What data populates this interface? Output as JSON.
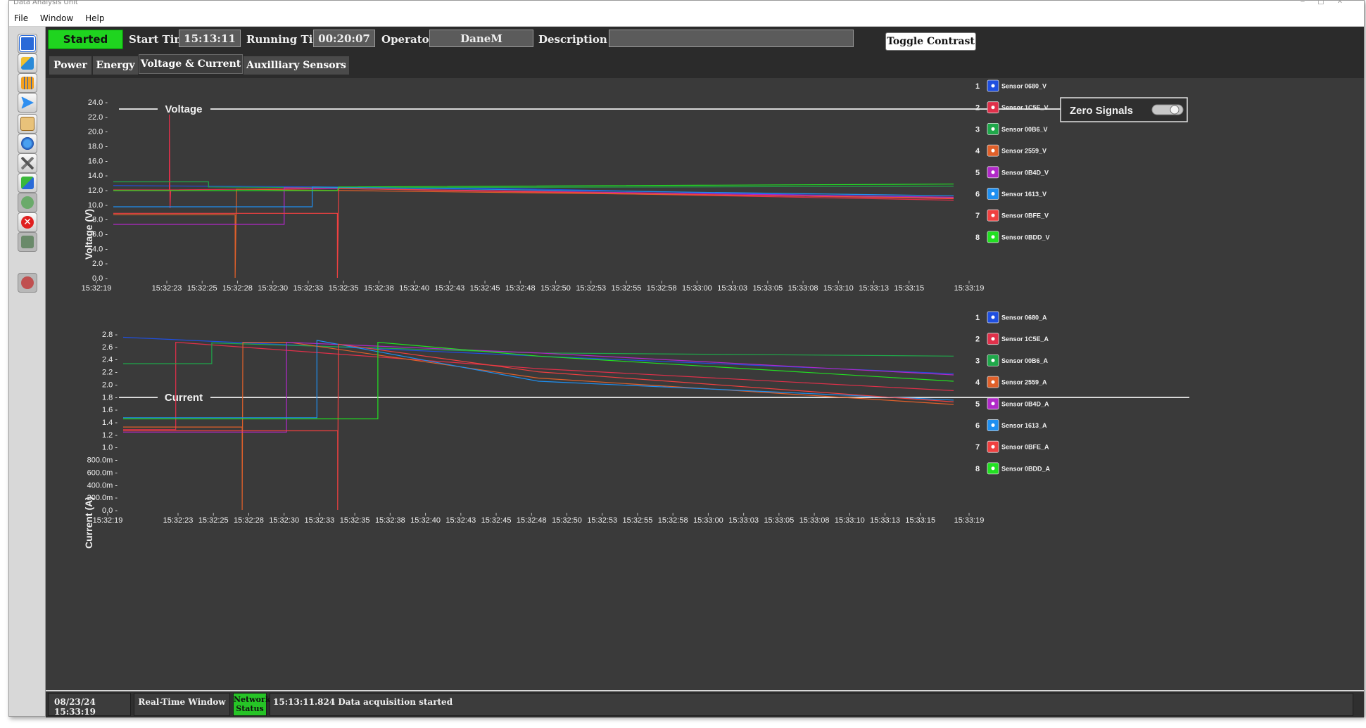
{
  "window": {
    "title": "Data Analysis Unit"
  },
  "menu": [
    "File",
    "Window",
    "Help"
  ],
  "toolbar_icons": [
    "window-icon",
    "monitor-icon",
    "calendar-icon",
    "send-icon",
    "notes-icon",
    "globe-icon",
    "tools-icon",
    "refresh-icon",
    "play-icon",
    "stop-icon",
    "download-icon",
    "power-icon"
  ],
  "topbar": {
    "status": "Started",
    "start_time_label": "Start Time",
    "start_time": "15:13:11",
    "running_time_label": "Running Time",
    "running_time": "00:20:07",
    "operator_label": "Operator",
    "operator": "DaneM",
    "description_label": "Description",
    "description": "",
    "toggle_contrast": "Toggle Contrast"
  },
  "tabs": [
    "Power",
    "Energy",
    "Voltage & Current",
    "Auxilliary Sensors"
  ],
  "active_tab": "Voltage & Current",
  "zero_signals_label": "Zero Signals",
  "legend_voltage": [
    {
      "num": "1",
      "name": "Sensor 0680_V",
      "color": "#1f4fe0"
    },
    {
      "num": "2",
      "name": "Sensor 1C5E_V",
      "color": "#e0304a"
    },
    {
      "num": "3",
      "name": "Sensor 00B6_V",
      "color": "#1fa84a"
    },
    {
      "num": "4",
      "name": "Sensor 2559_V",
      "color": "#e0602a"
    },
    {
      "num": "5",
      "name": "Sensor 0B4D_V",
      "color": "#b028c8"
    },
    {
      "num": "6",
      "name": "Sensor 1613_V",
      "color": "#1e8ff0"
    },
    {
      "num": "7",
      "name": "Sensor 0BFE_V",
      "color": "#f04040"
    },
    {
      "num": "8",
      "name": "Sensor 0BDD_V",
      "color": "#22e022"
    }
  ],
  "legend_current": [
    {
      "num": "1",
      "name": "Sensor 0680_A",
      "color": "#1f4fe0"
    },
    {
      "num": "2",
      "name": "Sensor 1C5E_A",
      "color": "#e0304a"
    },
    {
      "num": "3",
      "name": "Sensor 00B6_A",
      "color": "#1fa84a"
    },
    {
      "num": "4",
      "name": "Sensor 2559_A",
      "color": "#e0602a"
    },
    {
      "num": "5",
      "name": "Sensor 0B4D_A",
      "color": "#b028c8"
    },
    {
      "num": "6",
      "name": "Sensor 1613_A",
      "color": "#1e8ff0"
    },
    {
      "num": "7",
      "name": "Sensor 0BFE_A",
      "color": "#f04040"
    },
    {
      "num": "8",
      "name": "Sensor 0BDD_A",
      "color": "#22e022"
    }
  ],
  "chart_data": [
    {
      "type": "line",
      "title": "Voltage",
      "ylabel": "Voltage (V)",
      "xlabel": "",
      "ylim": [
        0,
        24
      ],
      "yticks": [
        "24.0",
        "22.0",
        "20.0",
        "18.0",
        "16.0",
        "14.0",
        "12.0",
        "10.0",
        "8.0",
        "6.0",
        "4.0",
        "2.0",
        "0.0"
      ],
      "xticks": [
        "15:32:19",
        "15:32:23",
        "15:32:25",
        "15:32:28",
        "15:32:30",
        "15:32:33",
        "15:32:35",
        "15:32:38",
        "15:32:40",
        "15:32:43",
        "15:32:45",
        "15:32:48",
        "15:32:50",
        "15:32:53",
        "15:32:55",
        "15:32:58",
        "15:33:00",
        "15:33:03",
        "15:33:05",
        "15:33:08",
        "15:33:10",
        "15:33:13",
        "15:33:15",
        "15:33:19"
      ],
      "xrange_sec": [
        0,
        60
      ],
      "series": [
        {
          "name": "Sensor 0680_V",
          "color": "#1f4fe0",
          "points": [
            [
              0,
              12.6
            ],
            [
              15,
              12.4
            ],
            [
              28,
              12.2
            ],
            [
              60,
              10.9
            ]
          ]
        },
        {
          "name": "Sensor 1C5E_V",
          "color": "#e0304a",
          "points": [
            [
              0,
              12.0
            ],
            [
              4,
              12.0
            ],
            [
              4,
              22.3
            ],
            [
              4.05,
              9.5
            ],
            [
              4.1,
              12.0
            ],
            [
              16,
              12.2
            ],
            [
              60,
              10.6
            ]
          ]
        },
        {
          "name": "Sensor 00B6_V",
          "color": "#1fa84a",
          "points": [
            [
              0,
              13.1
            ],
            [
              6.8,
              13.1
            ],
            [
              6.8,
              12.4
            ],
            [
              16,
              12.3
            ],
            [
              60,
              12.5
            ]
          ]
        },
        {
          "name": "Sensor 2559_V",
          "color": "#e0602a",
          "points": [
            [
              0,
              8.6
            ],
            [
              8.7,
              8.6
            ],
            [
              8.7,
              0
            ],
            [
              8.8,
              12.1
            ],
            [
              60,
              10.9
            ]
          ]
        },
        {
          "name": "Sensor 0B4D_V",
          "color": "#b028c8",
          "points": [
            [
              0,
              7.3
            ],
            [
              12.2,
              7.3
            ],
            [
              12.2,
              12.3
            ],
            [
              60,
              11.0
            ]
          ]
        },
        {
          "name": "Sensor 1613_V",
          "color": "#1e8ff0",
          "points": [
            [
              0,
              9.7
            ],
            [
              14.2,
              9.7
            ],
            [
              14.2,
              12.4
            ],
            [
              60,
              11.2
            ]
          ]
        },
        {
          "name": "Sensor 0BFE_V",
          "color": "#f04040",
          "points": [
            [
              0,
              8.8
            ],
            [
              16,
              8.8
            ],
            [
              16,
              0
            ],
            [
              16.1,
              12.2
            ],
            [
              60,
              10.8
            ]
          ]
        },
        {
          "name": "Sensor 0BDD_V",
          "color": "#22e022",
          "points": [
            [
              0,
              11.9
            ],
            [
              16,
              11.9
            ],
            [
              16.1,
              12.4
            ],
            [
              60,
              12.8
            ]
          ]
        }
      ]
    },
    {
      "type": "line",
      "title": "Current",
      "ylabel": "Current (A)",
      "xlabel": "",
      "ylim": [
        0,
        2.8
      ],
      "yticks": [
        "2.8",
        "2.6",
        "2.4",
        "2.2",
        "2.0",
        "1.8",
        "1.6",
        "1.4",
        "1.2",
        "1.0",
        "800.0m",
        "600.0m",
        "400.0m",
        "200.0m",
        "0.0"
      ],
      "xticks": [
        "15:32:19",
        "15:32:23",
        "15:32:25",
        "15:32:28",
        "15:32:30",
        "15:32:33",
        "15:32:35",
        "15:32:38",
        "15:32:40",
        "15:32:43",
        "15:32:45",
        "15:32:48",
        "15:32:50",
        "15:32:53",
        "15:32:55",
        "15:32:58",
        "15:33:00",
        "15:33:03",
        "15:33:05",
        "15:33:08",
        "15:33:10",
        "15:33:13",
        "15:33:15",
        "15:33:19"
      ],
      "xrange_sec": [
        0,
        60
      ],
      "series": [
        {
          "name": "Sensor 0680_A",
          "color": "#1f4fe0",
          "points": [
            [
              0,
              2.75
            ],
            [
              15,
              2.6
            ],
            [
              30,
              2.45
            ],
            [
              60,
              2.17
            ]
          ]
        },
        {
          "name": "Sensor 1C5E_A",
          "color": "#e0304a",
          "points": [
            [
              0,
              1.28
            ],
            [
              3.8,
              1.28
            ],
            [
              3.8,
              2.67
            ],
            [
              30,
              2.25
            ],
            [
              60,
              1.9
            ]
          ]
        },
        {
          "name": "Sensor 00B6_A",
          "color": "#1fa84a",
          "points": [
            [
              0,
              2.33
            ],
            [
              6.4,
              2.33
            ],
            [
              6.4,
              2.66
            ],
            [
              30,
              2.5
            ],
            [
              60,
              2.45
            ]
          ]
        },
        {
          "name": "Sensor 2559_A",
          "color": "#e0602a",
          "points": [
            [
              0,
              1.32
            ],
            [
              8.6,
              1.32
            ],
            [
              8.6,
              0
            ],
            [
              8.65,
              2.67
            ],
            [
              12,
              2.67
            ],
            [
              30,
              2.1
            ],
            [
              60,
              1.68
            ]
          ]
        },
        {
          "name": "Sensor 0B4D_A",
          "color": "#b028c8",
          "points": [
            [
              0,
              1.24
            ],
            [
              11.8,
              1.24
            ],
            [
              11.8,
              2.67
            ],
            [
              30,
              2.5
            ],
            [
              60,
              2.15
            ]
          ]
        },
        {
          "name": "Sensor 1613_A",
          "color": "#1e8ff0",
          "points": [
            [
              0,
              1.47
            ],
            [
              14,
              1.47
            ],
            [
              14,
              2.7
            ],
            [
              30,
              2.05
            ],
            [
              60,
              1.75
            ]
          ]
        },
        {
          "name": "Sensor 0BFE_A",
          "color": "#f04040",
          "points": [
            [
              0,
              1.26
            ],
            [
              15.5,
              1.26
            ],
            [
              15.5,
              0
            ],
            [
              15.55,
              2.64
            ],
            [
              30,
              2.2
            ],
            [
              60,
              1.72
            ]
          ]
        },
        {
          "name": "Sensor 0BDD_A",
          "color": "#22e022",
          "points": [
            [
              0,
              1.45
            ],
            [
              18.4,
              1.45
            ],
            [
              18.4,
              2.67
            ],
            [
              30,
              2.45
            ],
            [
              60,
              2.05
            ]
          ]
        }
      ]
    }
  ],
  "statusbar": {
    "datetime": "08/23/24 15:33:19",
    "window_mode": "Real-Time Window",
    "network_status": "Network Status",
    "message": "15:13:11.824 Data acquisition started"
  }
}
